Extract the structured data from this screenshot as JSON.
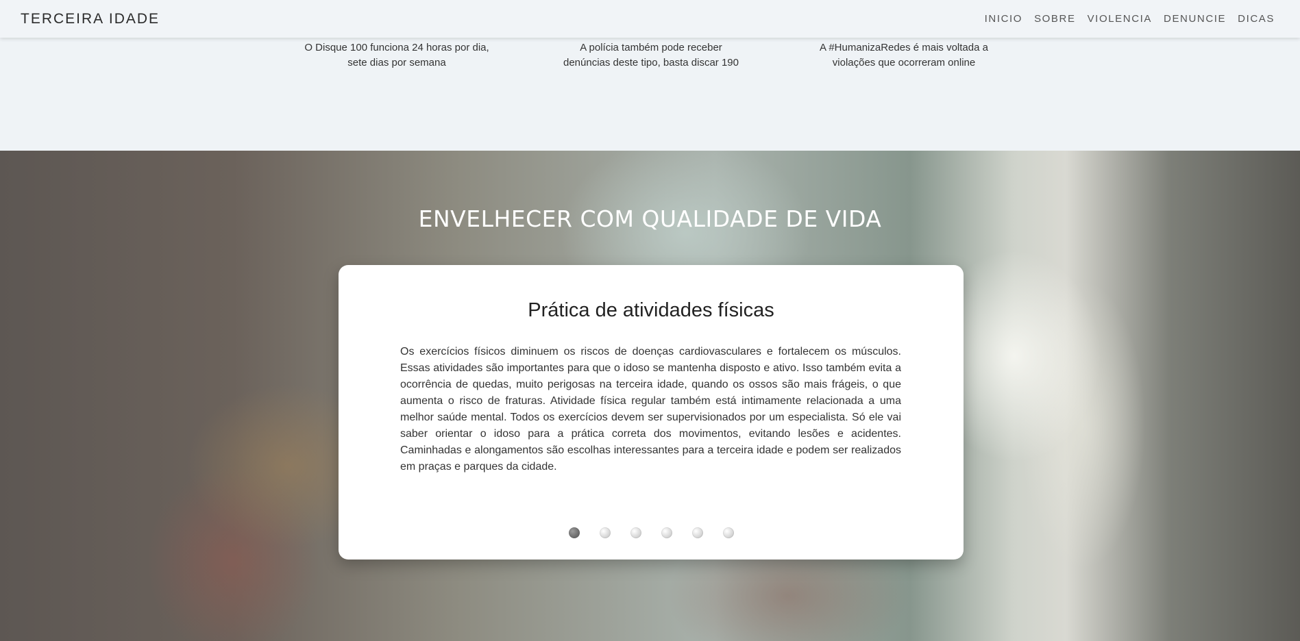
{
  "nav": {
    "brand": "TERCEIRA IDADE",
    "links": [
      "INICIO",
      "SOBRE",
      "VIOLENCIA",
      "DENUNCIE",
      "DICAS"
    ]
  },
  "contacts": [
    {
      "line1": "O Disque 100 funciona 24 horas por dia,",
      "line2": "sete dias por semana"
    },
    {
      "line1": "A polícia também pode receber",
      "line2": "denúncias deste tipo, basta discar 190"
    },
    {
      "line1": "A #HumanizaRedes é mais voltada a",
      "line2": "violações que ocorreram online"
    }
  ],
  "hero": {
    "title": "ENVELHECER COM QUALIDADE DE VIDA",
    "card": {
      "title": "Prática de atividades físicas",
      "text": "Os exercícios físicos diminuem os riscos de doenças cardiovasculares e fortalecem os músculos. Essas atividades são importantes para que o idoso se mantenha disposto e ativo. Isso também evita a ocorrência de quedas, muito perigosas na terceira idade, quando os ossos são mais frágeis, o que aumenta o risco de fraturas. Atividade física regular também está intimamente relacionada a uma melhor saúde mental. Todos os exercícios devem ser supervisionados por um especialista. Só ele vai saber orientar o idoso para a prática correta dos movimentos, evitando lesões e acidentes. Caminhadas e alongamentos são escolhas interessantes para a terceira idade e podem ser realizados em praças e parques da cidade."
    },
    "slides_total": 6,
    "active_slide": 1
  }
}
